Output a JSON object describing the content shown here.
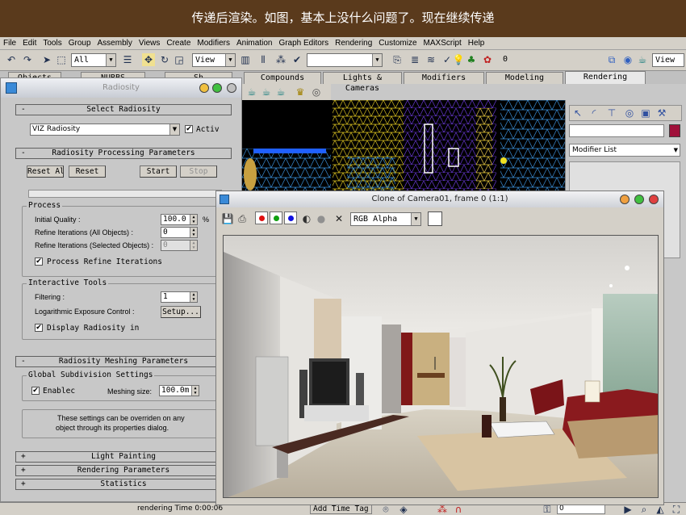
{
  "banner": {
    "text": "传递后渲染。如图，基本上没什么问题了。现在继续传递"
  },
  "menu": [
    "File",
    "Edit",
    "Tools",
    "Group",
    "Assembly",
    "Views",
    "Create",
    "Modifiers",
    "Animation",
    "Graph Editors",
    "Rendering",
    "Customize",
    "MAXScript",
    "Help"
  ],
  "toolbar": {
    "selection_filter": "All",
    "ref_coord": "View",
    "named_sel": "",
    "frame_value": "0",
    "view_right": "View"
  },
  "tabs": [
    {
      "label": "Objects"
    },
    {
      "label": "NURBS"
    },
    {
      "label": "Sh"
    },
    {
      "label": "Compounds"
    },
    {
      "label": "Lights & Cameras"
    },
    {
      "label": "Modifiers"
    },
    {
      "label": "Modeling"
    },
    {
      "label": "Rendering"
    }
  ],
  "radiosity": {
    "title": "Radiosity",
    "select_header": "Select Radiosity",
    "engine": "VIZ Radiosity",
    "active_label": "Activ",
    "processing_header": "Radiosity Processing Parameters",
    "btn_reset_all": "Reset All",
    "btn_reset": "Reset",
    "btn_start": "Start",
    "btn_stop": "Stop",
    "process_group": "Process",
    "initial_quality_label": "Initial Quality :",
    "initial_quality": "100.0",
    "percent": "%",
    "refine_all_label": "Refine Iterations (All Objects) :",
    "refine_all": "0",
    "refine_sel_label": "Refine Iterations (Selected Objects) :",
    "refine_sel": "0",
    "process_refine_label": "Process Refine Iterations",
    "interactive_group": "Interactive Tools",
    "filtering_label": "Filtering :",
    "filtering": "1",
    "log_exposure_label": "Logarithmic Exposure Control :",
    "setup_btn": "Setup...",
    "display_radiosity_label": "Display Radiosity in",
    "meshing_header": "Radiosity Meshing Parameters",
    "global_subdiv_group": "Global Subdivision Settings",
    "enable_label": "Enablec",
    "meshing_size_label": "Meshing size:",
    "meshing_size": "100.0m",
    "note_line1": "These settings can be overriden on any",
    "note_line2": "object through its properties dialog.",
    "light_painting": "Light Painting",
    "rendering_params": "Rendering Parameters",
    "statistics": "Statistics"
  },
  "render_window": {
    "title": "Clone of Camera01, frame 0 (1:1)",
    "channel": "RGB Alpha"
  },
  "right_panel": {
    "modifier_list": "Modifier List"
  },
  "status": {
    "left": "rendering Time  0:00:06",
    "add_time_tag": "Add Time Tag",
    "frame": "0"
  },
  "colors": {
    "banner_bg": "#5a3a1c",
    "red_channel": "#e01010",
    "green_channel": "#10a010",
    "blue_channel": "#1010e0"
  }
}
